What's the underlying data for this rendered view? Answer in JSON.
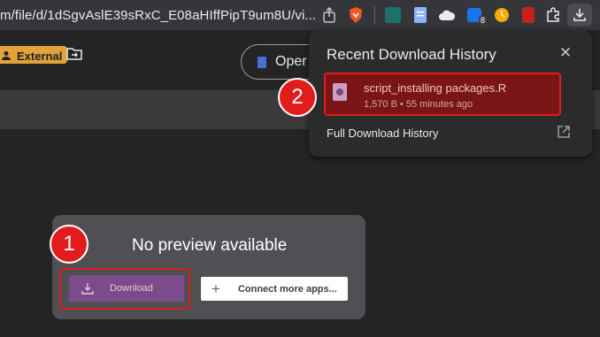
{
  "browser": {
    "url": "m/file/d/1dSgvAslE39sRxC_E08aHIffPipT9um8U/vi...",
    "extension_badge": "8"
  },
  "viewer": {
    "external_label": "External",
    "open_label": "Oper"
  },
  "preview": {
    "title": "No preview available",
    "download_label": "Download",
    "connect_label": "Connect more apps..."
  },
  "steps": [
    "1",
    "2"
  ],
  "download_popup": {
    "title": "Recent Download History",
    "item_name": "script_installing packages.R",
    "item_meta": "1,570 B • 55 minutes ago",
    "full_history_label": "Full Download History"
  },
  "colors": {
    "highlight": "#e21c1c",
    "external_chip": "#e3a33a",
    "download_button": "#7d4b8b"
  }
}
